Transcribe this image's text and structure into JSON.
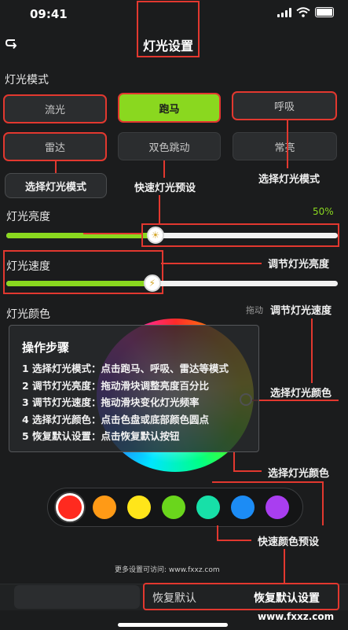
{
  "status": {
    "time": "09:41"
  },
  "header": {
    "title": "灯光设置"
  },
  "mode": {
    "label": "灯光模式",
    "buttons": [
      "流光",
      "跑马",
      "呼吸",
      "雷达",
      "双色跳动",
      "常亮"
    ],
    "active": "跑马"
  },
  "brightness": {
    "label": "灯光亮度",
    "value_text": "50%",
    "value": 0.45
  },
  "speed": {
    "label": "灯光速度",
    "value": 0.44
  },
  "color": {
    "label": "灯光颜色",
    "drag_hint": "拖动"
  },
  "steps": {
    "title": "操作步骤",
    "items": [
      "1 选择灯光模式：点击跑马、呼吸、雷达等模式",
      "2 调节灯光亮度：拖动滑块调整亮度百分比",
      "3 调节灯光速度：拖动滑块变化灯光频率",
      "4 选择灯光颜色：点击色盘或底部颜色圆点",
      "5 恢复默认设置：点击恢复默认按钮"
    ]
  },
  "annotations": {
    "select_mode_left": "选择灯光模式",
    "quick_preset": "快速灯光预设",
    "select_mode_right": "选择灯光模式",
    "adjust_brightness": "调节灯光亮度",
    "adjust_speed": "调节灯光速度",
    "select_color_right": "选择灯光颜色",
    "select_color_bottom": "选择灯光颜色",
    "quick_color_preset": "快速颜色预设",
    "reset_default": "恢复默认设置"
  },
  "swatches": [
    "#ff2a1f",
    "#ff9a16",
    "#ffe51a",
    "#6ad61c",
    "#17e0a8",
    "#1c8cf5",
    "#a93ef0"
  ],
  "footer": {
    "more_settings": "更多设置可访问: www.fxxz.com",
    "reset_label": "恢复默认"
  },
  "watermark": "www.fxxz.com"
}
